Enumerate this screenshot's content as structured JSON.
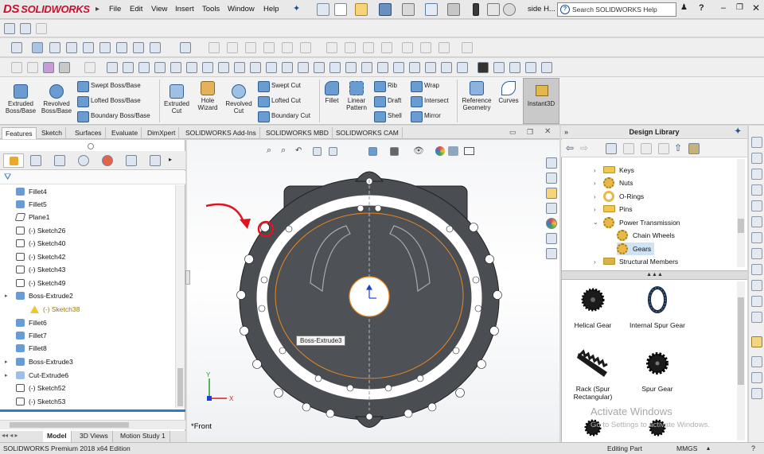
{
  "app": {
    "logo_text": "SOLIDWORKS",
    "logo_mark": "DS",
    "document_name": "side H...",
    "search_placeholder": "Search SOLIDWORKS Help",
    "menu": [
      "File",
      "Edit",
      "View",
      "Insert",
      "Tools",
      "Window",
      "Help"
    ]
  },
  "command_manager": {
    "features": [
      {
        "label": "Extruded Boss/Base"
      },
      {
        "label": "Revolved Boss/Base"
      },
      {
        "label": "Swept Boss/Base"
      },
      {
        "label": "Lofted Boss/Base"
      },
      {
        "label": "Boundary Boss/Base"
      },
      {
        "label": "Extruded Cut"
      },
      {
        "label": "Hole Wizard"
      },
      {
        "label": "Revolved Cut"
      },
      {
        "label": "Swept Cut"
      },
      {
        "label": "Lofted Cut"
      },
      {
        "label": "Boundary Cut"
      },
      {
        "label": "Fillet"
      },
      {
        "label": "Linear Pattern"
      },
      {
        "label": "Rib"
      },
      {
        "label": "Draft"
      },
      {
        "label": "Shell"
      },
      {
        "label": "Wrap"
      },
      {
        "label": "Intersect"
      },
      {
        "label": "Mirror"
      },
      {
        "label": "Reference Geometry"
      },
      {
        "label": "Curves"
      },
      {
        "label": "Instant3D"
      }
    ],
    "tabs": [
      "Features",
      "Sketch",
      "Surfaces",
      "Evaluate",
      "DimXpert",
      "SOLIDWORKS Add-Ins",
      "SOLIDWORKS MBD",
      "SOLIDWORKS CAM"
    ],
    "active_tab": "Features"
  },
  "feature_tree": {
    "items": [
      {
        "label": "Fillet4",
        "type": "fillet",
        "level": 1
      },
      {
        "label": "Fillet5",
        "type": "fillet",
        "level": 1
      },
      {
        "label": "Plane1",
        "type": "plane",
        "level": 1
      },
      {
        "label": "(-) Sketch26",
        "type": "sketch",
        "level": 1
      },
      {
        "label": "(-) Sketch40",
        "type": "sketch",
        "level": 1
      },
      {
        "label": "(-) Sketch42",
        "type": "sketch",
        "level": 1
      },
      {
        "label": "(-) Sketch43",
        "type": "sketch",
        "level": 1
      },
      {
        "label": "(-) Sketch49",
        "type": "sketch",
        "level": 1
      },
      {
        "label": "Boss-Extrude2",
        "type": "extrude",
        "level": 1,
        "expandable": true
      },
      {
        "label": "(-) Sketch38",
        "type": "warning",
        "level": 2
      },
      {
        "label": "Fillet6",
        "type": "fillet",
        "level": 1
      },
      {
        "label": "Fillet7",
        "type": "fillet",
        "level": 1
      },
      {
        "label": "Fillet8",
        "type": "fillet",
        "level": 1
      },
      {
        "label": "Boss-Extrude3",
        "type": "extrude",
        "level": 1,
        "expandable": true
      },
      {
        "label": "Cut-Extrude6",
        "type": "cut",
        "level": 1,
        "expandable": true
      },
      {
        "label": "(-) Sketch52",
        "type": "sketch",
        "level": 1
      },
      {
        "label": "(-) Sketch53",
        "type": "sketch",
        "level": 1
      }
    ]
  },
  "model_tabs": [
    "Model",
    "3D Views",
    "Motion Study 1"
  ],
  "active_model_tab": "Model",
  "viewport": {
    "view_label": "*Front",
    "tooltip": "Boss-Extrude3",
    "triad_y": "Y",
    "triad_x": "X"
  },
  "design_library": {
    "title": "Design Library",
    "tree": [
      {
        "label": "Keys",
        "icon": "folder",
        "expanded": false
      },
      {
        "label": "Nuts",
        "icon": "gear",
        "expanded": false
      },
      {
        "label": "O-Rings",
        "icon": "ring",
        "expanded": false
      },
      {
        "label": "Pins",
        "icon": "folder",
        "expanded": false
      },
      {
        "label": "Power Transmission",
        "icon": "gear",
        "expanded": true
      },
      {
        "label": "Chain Wheels",
        "icon": "gear",
        "child": true
      },
      {
        "label": "Gears",
        "icon": "gear",
        "child": true,
        "selected": true
      },
      {
        "label": "Structural Members",
        "icon": "beam",
        "expanded": false
      }
    ],
    "parts": [
      {
        "label": "Helical Gear"
      },
      {
        "label": "Internal Spur Gear"
      },
      {
        "label": "Rack (Spur Rectangular)"
      },
      {
        "label": "Spur Gear"
      }
    ],
    "watermark_title": "Activate Windows",
    "watermark_sub": "Go to Settings to activate Windows."
  },
  "status": {
    "edition": "SOLIDWORKS Premium 2018 x64 Edition",
    "mode": "Editing Part",
    "units": "MMGS"
  },
  "colors": {
    "logo": "#c8102e",
    "part_fill": "#4a4d52",
    "annotation": "#e0141e",
    "edge_highlight": "#e8891f"
  }
}
